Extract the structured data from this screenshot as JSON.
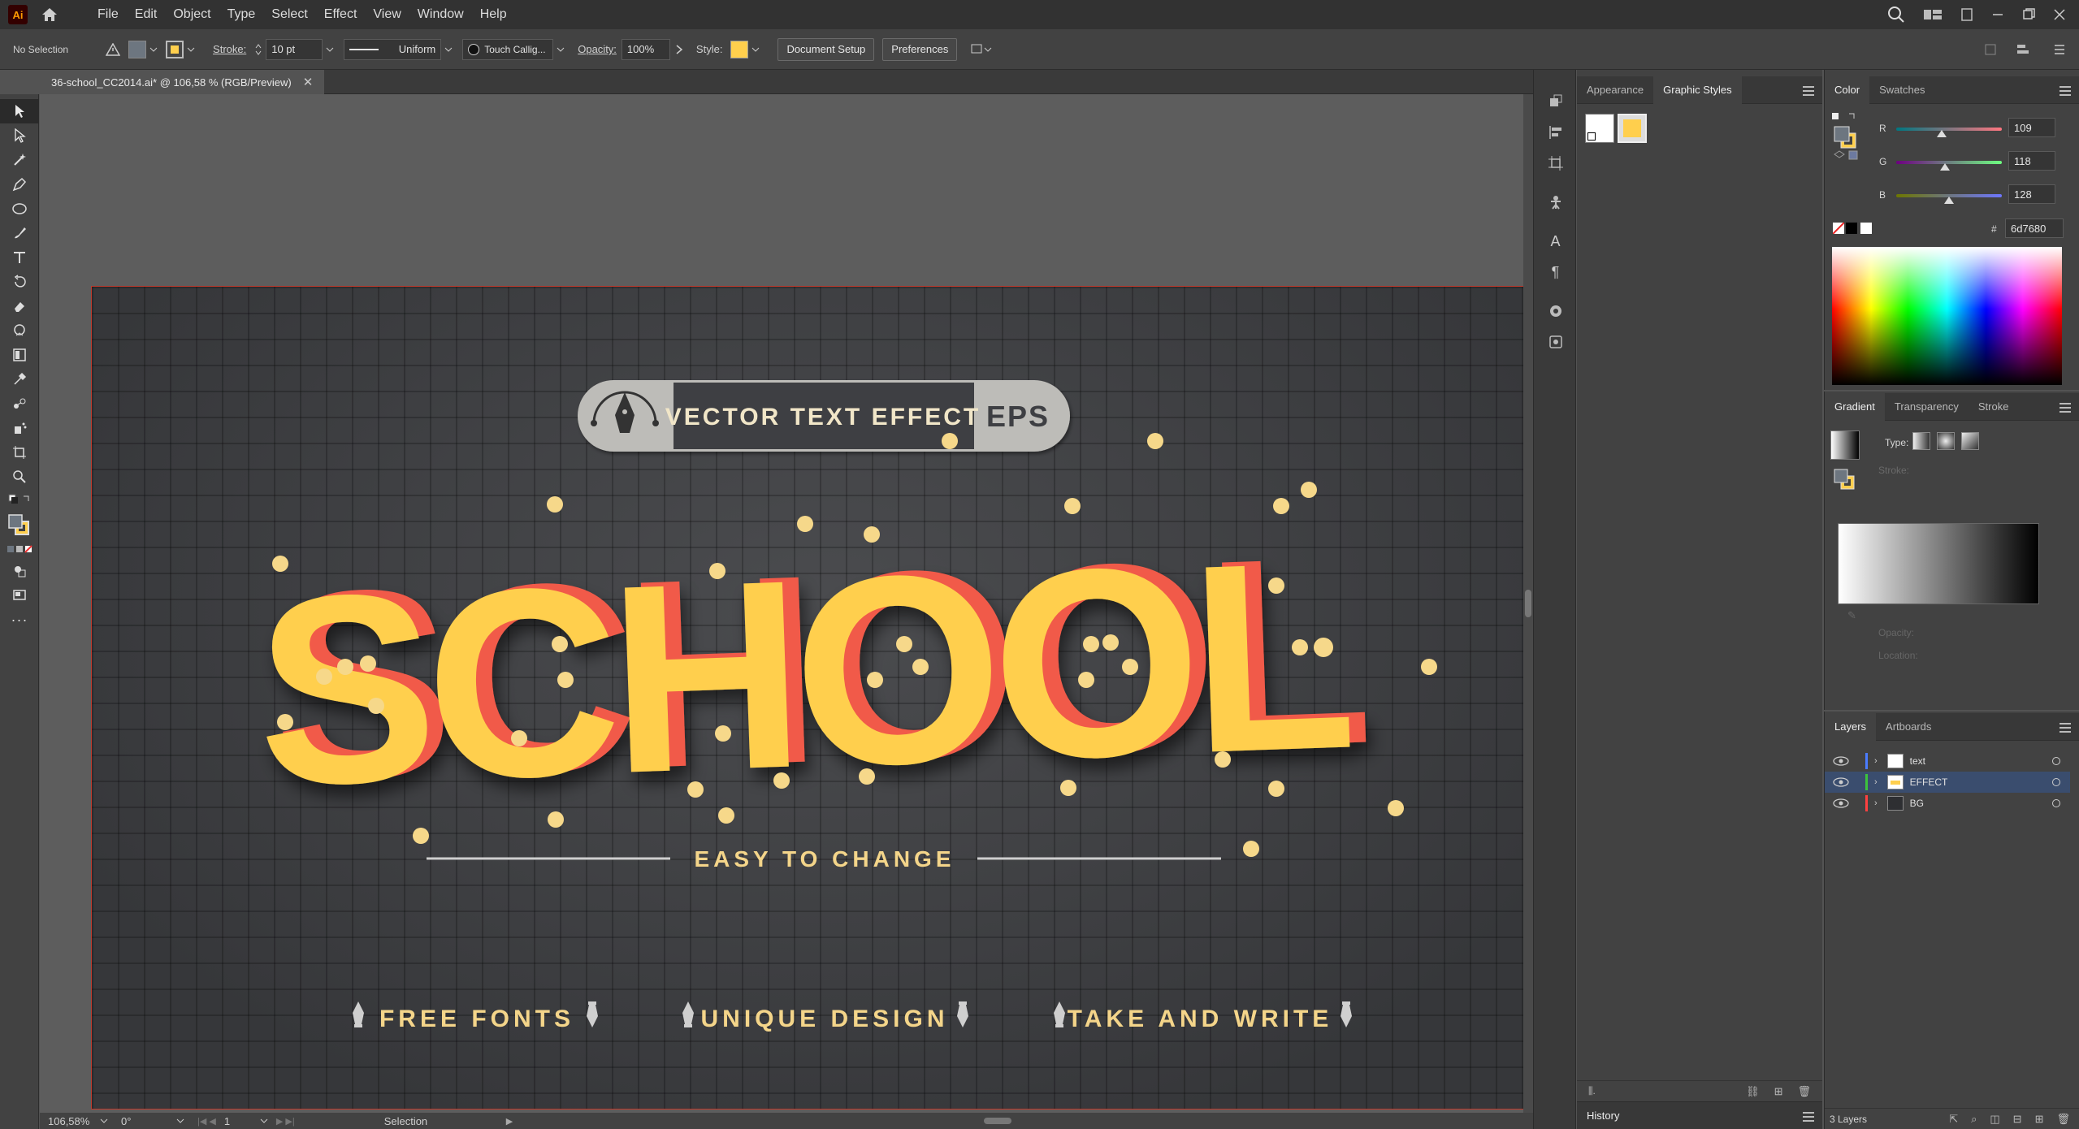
{
  "app": {
    "logo": "Ai"
  },
  "menu": [
    "File",
    "Edit",
    "Object",
    "Type",
    "Select",
    "Effect",
    "View",
    "Window",
    "Help"
  ],
  "control_bar": {
    "selection": "No Selection",
    "stroke_label": "Stroke:",
    "stroke_value": "10 pt",
    "profile": "Uniform",
    "brush": "Touch Callig...",
    "opacity_label": "Opacity:",
    "opacity_value": "100%",
    "style_label": "Style:",
    "doc_setup": "Document Setup",
    "preferences": "Preferences"
  },
  "document": {
    "tab_title": "36-school_CC2014.ai* @ 106,58 % (RGB/Preview)"
  },
  "artwork": {
    "badge_text": "VECTOR TEXT EFFECT",
    "badge_eps": "EPS",
    "headline": "SCHOOL",
    "subtitle": "EASY TO CHANGE",
    "features": [
      "FREE FONTS",
      "UNIQUE DESIGN",
      "TAKE AND WRITE"
    ],
    "accent": "#ffcf4d",
    "shadow_red": "#f15a4a"
  },
  "status": {
    "zoom": "106,58%",
    "rotation": "0°",
    "artboard": "1",
    "tool": "Selection"
  },
  "appearance_panel": {
    "tabs": [
      "Appearance",
      "Graphic Styles"
    ],
    "active": "Graphic Styles"
  },
  "color_panel": {
    "tabs": [
      "Color",
      "Swatches"
    ],
    "r": "109",
    "g": "118",
    "b": "128",
    "hex": "6d7680",
    "r_label": "R",
    "g_label": "G",
    "b_label": "B",
    "hash": "#"
  },
  "gradient_panel": {
    "tabs": [
      "Gradient",
      "Transparency",
      "Stroke"
    ],
    "type_label": "Type:",
    "stroke_label": "Stroke:",
    "opacity_label": "Opacity:",
    "location_label": "Location:"
  },
  "layers_panel": {
    "tabs": [
      "Layers",
      "Artboards"
    ],
    "layers": [
      {
        "name": "text",
        "color": "#4a7cff"
      },
      {
        "name": "EFFECT",
        "color": "#3cc33c"
      },
      {
        "name": "BG",
        "color": "#ff4040"
      }
    ],
    "count": "3 Layers"
  },
  "history_panel": {
    "title": "History"
  }
}
